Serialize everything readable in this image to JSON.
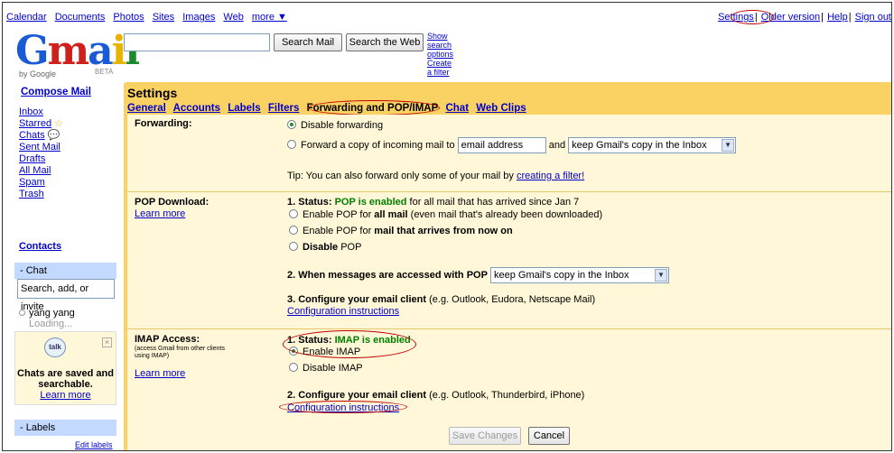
{
  "topnav": {
    "left_links": [
      "Calendar",
      "Documents",
      "Photos",
      "Sites",
      "Images",
      "Web"
    ],
    "more": "more ▼",
    "right_links": [
      "Settings",
      "Older version",
      "Help",
      "Sign out"
    ]
  },
  "logo": {
    "text": "Gmail",
    "by": "by Google",
    "beta": "BETA"
  },
  "search": {
    "search_mail": "Search Mail",
    "search_web": "Search the Web",
    "show_options": "Show search options",
    "create_filter": "Create a filter"
  },
  "nav": {
    "compose": "Compose Mail",
    "items": [
      "Inbox",
      "Starred",
      "Chats",
      "Sent Mail",
      "Drafts",
      "All Mail",
      "Spam",
      "Trash"
    ],
    "contacts": "Contacts"
  },
  "chat": {
    "header": "- Chat",
    "search_placeholder": "Search, add, or invite",
    "user": "yang yang",
    "status": "Loading...",
    "talk_icon": "talk",
    "talk_message": "Chats are saved and searchable.",
    "learn_more": "Learn more"
  },
  "labels": {
    "header": "- Labels",
    "edit": "Edit labels"
  },
  "settings": {
    "title": "Settings",
    "tabs": [
      "General",
      "Accounts",
      "Labels",
      "Filters",
      "Forwarding and POP/IMAP",
      "Chat",
      "Web Clips"
    ],
    "forwarding": {
      "label": "Forwarding:",
      "disable": "Disable forwarding",
      "forward_prefix": "Forward a copy of incoming mail to",
      "email_value": "email address",
      "and": "and",
      "copy_option": "keep Gmail's copy in the Inbox",
      "tip_prefix": "Tip: You can also forward only some of your mail by",
      "tip_link": "creating a filter!"
    },
    "pop": {
      "label": "POP Download:",
      "learn_more": "Learn more",
      "status_prefix": "1. Status:",
      "status_value": "POP is enabled",
      "status_suffix": "for all mail that has arrived since Jan 7",
      "opt1_prefix": "Enable POP for",
      "opt1_bold": "all mail",
      "opt1_suffix": "(even mail that's already been downloaded)",
      "opt2_prefix": "Enable POP for",
      "opt2_bold": "mail that arrives from now on",
      "opt3_bold": "Disable",
      "opt3_suffix": "POP",
      "access_label": "2. When messages are accessed with POP",
      "access_option": "keep Gmail's copy in the Inbox",
      "configure_bold": "3. Configure your email client",
      "configure_suffix": "(e.g. Outlook, Eudora, Netscape Mail)",
      "config_link": "Configuration instructions"
    },
    "imap": {
      "label": "IMAP Access:",
      "note": "(access Gmail from other clients using IMAP)",
      "learn_more": "Learn more",
      "status_prefix": "1. Status:",
      "status_value": "IMAP is enabled",
      "enable": "Enable IMAP",
      "disable": "Disable IMAP",
      "configure_bold": "2. Configure your email client",
      "configure_suffix": "(e.g. Outlook, Thunderbird, iPhone)",
      "config_link": "Configuration instructions"
    },
    "save": "Save Changes",
    "cancel": "Cancel"
  },
  "colors": {
    "accent": "#fad163",
    "panel": "#fff7d7",
    "link": "#0000cc",
    "enabled": "#008000",
    "annotation": "#c00000"
  }
}
